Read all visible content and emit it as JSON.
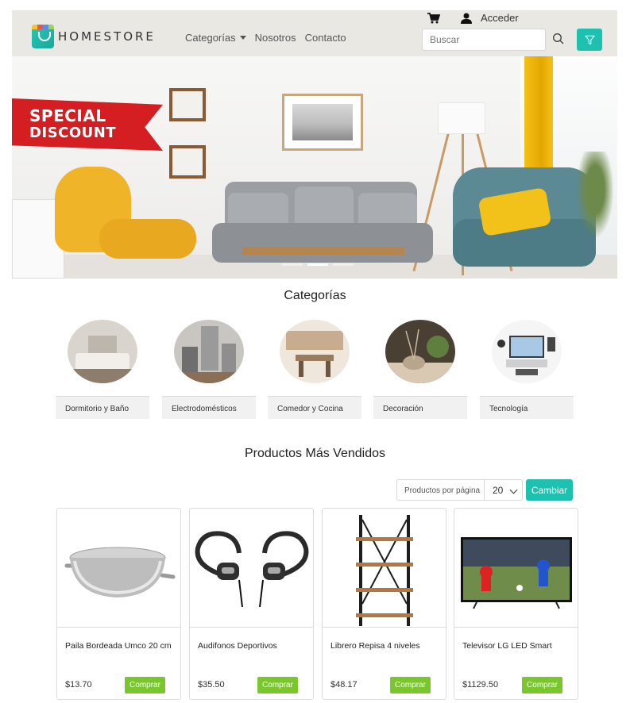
{
  "brand": {
    "name": "HOMESTORE"
  },
  "nav": {
    "links": [
      "Categorías",
      "Nosotros",
      "Contacto"
    ],
    "login_label": "Acceder",
    "search_placeholder": "Buscar"
  },
  "hero": {
    "ribbon_line1": "SPECIAL",
    "ribbon_line2": "DISCOUNT",
    "slides": 3,
    "active_slide": 2
  },
  "categories": {
    "title": "Categorías",
    "items": [
      {
        "label": "Dormitorio y Baño"
      },
      {
        "label": "Electrodomésticos"
      },
      {
        "label": "Comedor y Cocina"
      },
      {
        "label": "Decoración"
      },
      {
        "label": "Tecnología"
      }
    ]
  },
  "products": {
    "title": "Productos Más Vendidos",
    "per_page_label": "Productos por página",
    "per_page_value": "20",
    "change_label": "Cambiar",
    "buy_label": "Comprar",
    "items": [
      {
        "name": "Paila Bordeada Umco 20 cm",
        "price": "$13.70"
      },
      {
        "name": "Audifonos Deportivos",
        "price": "$35.50"
      },
      {
        "name": "Librero Repisa 4 niveles",
        "price": "$48.17"
      },
      {
        "name": "Televisor LG LED Smart",
        "price": "$1129.50"
      }
    ]
  },
  "colors": {
    "accent": "#1ec0b0",
    "buy": "#79c72c",
    "navbar_bg": "#e9e8e3",
    "ribbon": "#d41e22"
  }
}
